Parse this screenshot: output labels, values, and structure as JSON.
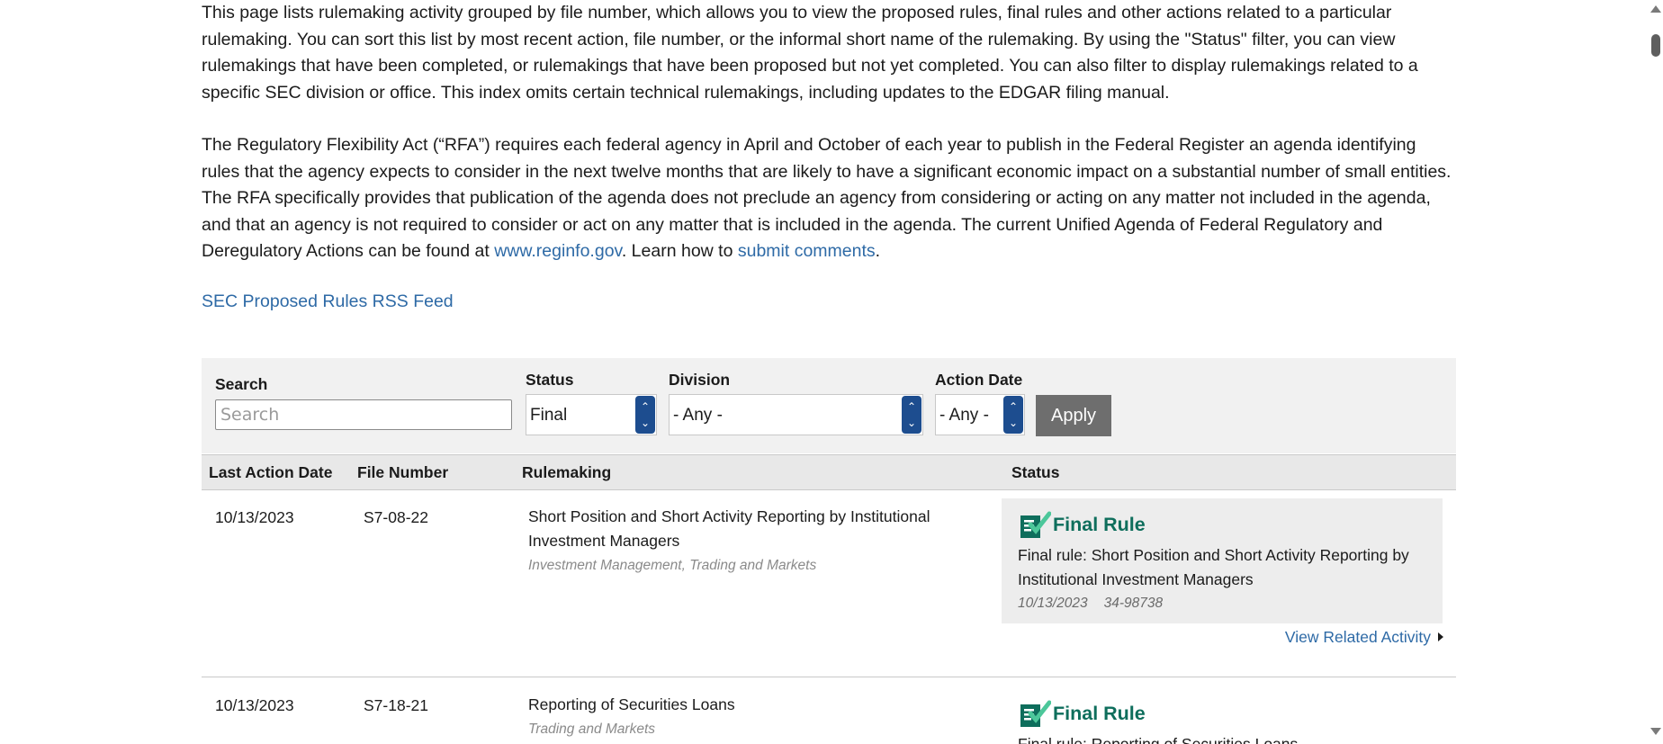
{
  "intro": {
    "p1": "This page lists rulemaking activity grouped by file number, which allows you to view the proposed rules, final rules and other actions related to a particular rulemaking. You can sort this list by most recent action, file number, or the informal short name of the rulemaking. By using the \"Status\" filter, you can view rulemakings that have been completed, or rulemakings that have been proposed but not yet completed. You can also filter to display rulemakings related to a specific SEC division or office. This index omits certain technical rulemakings, including updates to the EDGAR filing manual.",
    "p2_before": "The Regulatory Flexibility Act (“RFA”) requires each federal agency in April and October of each year to publish in the Federal Register an agenda identifying rules that the agency expects to consider in the next twelve months that are likely to have a significant economic impact on a substantial number of small entities. The RFA specifically provides that publication of the agenda does not preclude an agency from considering or acting on any matter not included in the agenda, and that an agency is not required to consider or act on any matter that is included in the agenda. The current Unified Agenda of Federal Regulatory and Deregulatory Actions can be found at ",
    "p2_link1": "www.reginfo.gov",
    "p2_middle": ". Learn how to ",
    "p2_link2": "submit comments",
    "p2_after": "."
  },
  "rss_link": "SEC Proposed Rules RSS Feed",
  "filters": {
    "search_label": "Search",
    "search_placeholder": "Search",
    "search_value": "",
    "status_label": "Status",
    "status_value": "Final",
    "division_label": "Division",
    "division_value": "- Any -",
    "action_date_label": "Action Date",
    "action_date_value": "- Any -",
    "apply_label": "Apply"
  },
  "table": {
    "headers": [
      "Last Action Date",
      "File Number",
      "Rulemaking",
      "Status"
    ],
    "rows": [
      {
        "date": "10/13/2023",
        "file_number": "S7-08-22",
        "title": "Short Position and Short Activity Reporting by Institutional Investment Managers",
        "divisions": "Investment Management, Trading and Markets",
        "status_label": "Final Rule",
        "status_desc": "Final rule: Short Position and Short Activity Reporting by Institutional Investment Managers",
        "status_date": "10/13/2023",
        "status_release": "34-98738",
        "related_link": "View Related Activity"
      },
      {
        "date": "10/13/2023",
        "file_number": "S7-18-21",
        "title": "Reporting of Securities Loans",
        "divisions": "Trading and Markets",
        "status_label": "Final Rule",
        "status_desc": "Final rule: Reporting of Securities Loans"
      }
    ]
  },
  "colors": {
    "link": "#2e6aa6",
    "status_green": "#0e6e5c",
    "spinner_blue": "#1d4d8f",
    "apply_gray": "#6e6e6e"
  },
  "icons": {
    "status": "final-rule-check-icon",
    "select_spinner": "updown-arrows-icon",
    "related": "caret-right-icon"
  }
}
